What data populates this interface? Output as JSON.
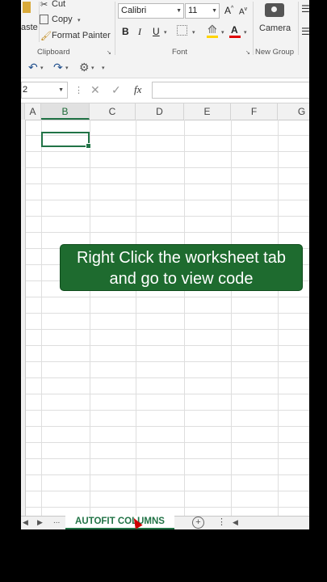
{
  "clipboard": {
    "paste_fragment": "aste",
    "cut_label": "Cut",
    "copy_label": "Copy",
    "format_painter_label": "Format Painter",
    "group_label": "Clipboard"
  },
  "font": {
    "font_name": "Calibri",
    "font_size": "11",
    "bold": "B",
    "italic": "I",
    "underline": "U",
    "grow": "A",
    "shrink": "A",
    "font_color_letter": "A",
    "group_label": "Font"
  },
  "new_group": {
    "camera_label": "Camera",
    "group_label": "New Group"
  },
  "formula_bar": {
    "name_box": "2",
    "fx": "fx"
  },
  "columns": [
    "A",
    "B",
    "C",
    "D",
    "E",
    "F",
    "G"
  ],
  "selected_column": "B",
  "callout": {
    "line1": "Right Click the worksheet tab",
    "line2": "and go to view code"
  },
  "sheet_tab": "AUTOFIT COLUMNS",
  "tabs_nav": {
    "ellipsis": "..."
  },
  "colors": {
    "accent": "#217346",
    "callout_bg": "#1e6b2f"
  }
}
